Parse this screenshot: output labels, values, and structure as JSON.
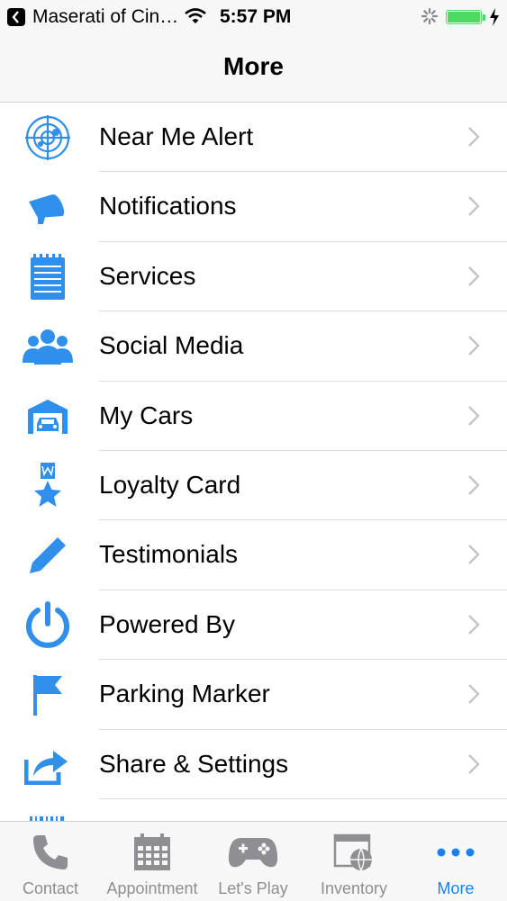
{
  "status_bar": {
    "carrier": "Maserati of Cin…",
    "time": "5:57 PM",
    "battery_level": 1.0
  },
  "nav": {
    "title": "More"
  },
  "colors": {
    "accent": "#2f8fea",
    "tab_active": "#1a82f0",
    "tab_inactive": "#8e8e93"
  },
  "menu": {
    "items": [
      {
        "label": "Near Me Alert",
        "icon": "radar-icon"
      },
      {
        "label": "Notifications",
        "icon": "megaphone-icon"
      },
      {
        "label": "Services",
        "icon": "notepad-icon"
      },
      {
        "label": "Social Media",
        "icon": "people-icon"
      },
      {
        "label": "My Cars",
        "icon": "garage-icon"
      },
      {
        "label": "Loyalty Card",
        "icon": "award-star-icon"
      },
      {
        "label": "Testimonials",
        "icon": "pencil-icon"
      },
      {
        "label": "Powered By",
        "icon": "power-icon"
      },
      {
        "label": "Parking Marker",
        "icon": "flag-icon"
      },
      {
        "label": "Share & Settings",
        "icon": "share-icon"
      }
    ]
  },
  "tabs": [
    {
      "label": "Contact",
      "icon": "phone-icon"
    },
    {
      "label": "Appointment",
      "icon": "calendar-icon"
    },
    {
      "label": "Let's Play",
      "icon": "gamepad-icon"
    },
    {
      "label": "Inventory",
      "icon": "browser-globe-icon"
    },
    {
      "label": "More",
      "icon": "more-dots-icon",
      "active": true
    }
  ]
}
